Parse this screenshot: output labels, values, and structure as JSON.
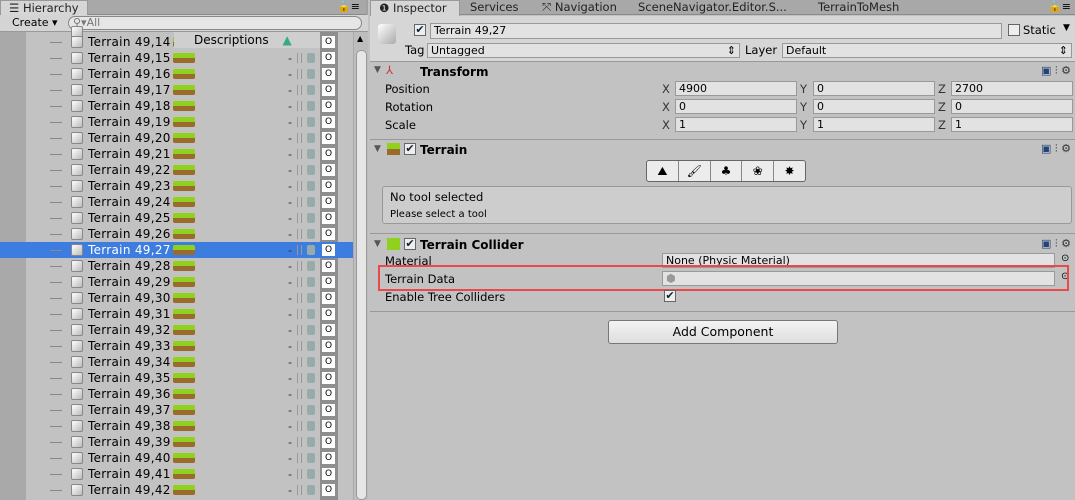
{
  "hierarchy": {
    "tab": "Hierarchy",
    "create": "Create",
    "search_placeholder": "All",
    "descriptions": "Descriptions",
    "o_label": "O",
    "dash": "-",
    "rows": [
      "Terrain 49,14",
      "Terrain 49,15",
      "Terrain 49,16",
      "Terrain 49,17",
      "Terrain 49,18",
      "Terrain 49,19",
      "Terrain 49,20",
      "Terrain 49,21",
      "Terrain 49,22",
      "Terrain 49,23",
      "Terrain 49,24",
      "Terrain 49,25",
      "Terrain 49,26",
      "Terrain 49,27",
      "Terrain 49,28",
      "Terrain 49,29",
      "Terrain 49,30",
      "Terrain 49,31",
      "Terrain 49,32",
      "Terrain 49,33",
      "Terrain 49,34",
      "Terrain 49,35",
      "Terrain 49,36",
      "Terrain 49,37",
      "Terrain 49,38",
      "Terrain 49,39",
      "Terrain 49,40",
      "Terrain 49,41",
      "Terrain 49,42"
    ],
    "selected": "Terrain 49,27"
  },
  "tabs": [
    "Inspector",
    "Services",
    "Navigation",
    "SceneNavigator.Editor.S...",
    "TerrainToMesh"
  ],
  "inspector": {
    "name": "Terrain 49,27",
    "static": "Static",
    "tag_label": "Tag",
    "tag": "Untagged",
    "layer_label": "Layer",
    "layer": "Default",
    "transform": {
      "title": "Transform",
      "position": {
        "label": "Position",
        "x": "4900",
        "y": "0",
        "z": "2700"
      },
      "rotation": {
        "label": "Rotation",
        "x": "0",
        "y": "0",
        "z": "0"
      },
      "scale": {
        "label": "Scale",
        "x": "1",
        "y": "1",
        "z": "1"
      }
    },
    "terrain": {
      "title": "Terrain",
      "msg1": "No tool selected",
      "msg2": "Please select a tool"
    },
    "collider": {
      "title": "Terrain Collider",
      "material_label": "Material",
      "material": "None (Physic Material)",
      "data_label": "Terrain Data",
      "trees_label": "Enable Tree Colliders"
    },
    "add_component": "Add Component"
  },
  "colors": {
    "selection": "#3e7de0",
    "highlight": "#e84a4a"
  }
}
